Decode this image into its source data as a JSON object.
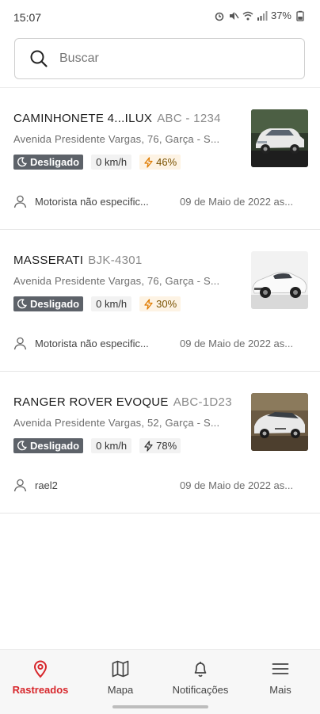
{
  "status_bar": {
    "time": "15:07",
    "battery": "37%"
  },
  "search": {
    "placeholder": "Buscar"
  },
  "vehicles": [
    {
      "name": "CAMINHONETE 4...ILUX",
      "plate": "ABC - 1234",
      "address": "Avenida Presidente Vargas, 76, Garça - S...",
      "status": "Desligado",
      "speed": "0 km/h",
      "battery": "46%",
      "battery_level": 46,
      "driver": "Motorista não especific...",
      "date": "09 de Maio de 2022 as..."
    },
    {
      "name": "MASSERATI",
      "plate": "BJK-4301",
      "address": "Avenida Presidente Vargas, 76, Garça - S...",
      "status": "Desligado",
      "speed": "0 km/h",
      "battery": "30%",
      "battery_level": 30,
      "driver": "Motorista não especific...",
      "date": "09 de Maio de 2022 as..."
    },
    {
      "name": "RANGER ROVER EVOQUE",
      "plate": "ABC-1D23",
      "address": "Avenida Presidente Vargas, 52, Garça - S...",
      "status": "Desligado",
      "speed": "0 km/h",
      "battery": "78%",
      "battery_level": 78,
      "driver": "rael2",
      "date": "09 de Maio de 2022 as..."
    }
  ],
  "bottom_nav": [
    {
      "label": "Rastreados",
      "icon": "location-pin-icon",
      "active": true
    },
    {
      "label": "Mapa",
      "icon": "map-icon",
      "active": false
    },
    {
      "label": "Notificações",
      "icon": "bell-icon",
      "active": false
    },
    {
      "label": "Mais",
      "icon": "menu-icon",
      "active": false
    }
  ],
  "colors": {
    "accent": "#d7262b",
    "badge_off": "#5d6269",
    "battery_warn_bg": "#fdf3e4",
    "battery_warn_icon": "#e07b00"
  }
}
